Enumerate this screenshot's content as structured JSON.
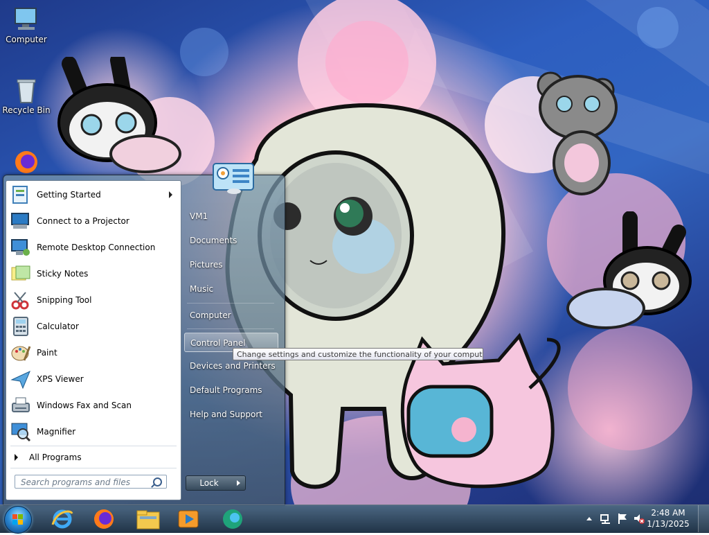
{
  "desktop": {
    "icons": [
      {
        "label": "Computer",
        "icon": "computer-icon"
      },
      {
        "label": "Recycle Bin",
        "icon": "recycle-bin-icon"
      },
      {
        "label": "",
        "icon": "firefox-icon"
      }
    ]
  },
  "start_menu": {
    "programs": [
      {
        "label": "Getting Started",
        "icon": "getting-started-icon",
        "has_submenu": true
      },
      {
        "label": "Connect to a Projector",
        "icon": "projector-icon"
      },
      {
        "label": "Remote Desktop Connection",
        "icon": "remote-desktop-icon"
      },
      {
        "label": "Sticky Notes",
        "icon": "sticky-notes-icon"
      },
      {
        "label": "Snipping Tool",
        "icon": "snipping-tool-icon"
      },
      {
        "label": "Calculator",
        "icon": "calculator-icon"
      },
      {
        "label": "Paint",
        "icon": "paint-icon"
      },
      {
        "label": "XPS Viewer",
        "icon": "xps-viewer-icon"
      },
      {
        "label": "Windows Fax and Scan",
        "icon": "fax-scan-icon"
      },
      {
        "label": "Magnifier",
        "icon": "magnifier-icon"
      }
    ],
    "all_programs": "All Programs",
    "search_placeholder": "Search programs and files",
    "right_items": [
      {
        "label": "VM1"
      },
      {
        "label": "Documents"
      },
      {
        "label": "Pictures"
      },
      {
        "label": "Music"
      },
      {
        "label": "Computer"
      },
      {
        "label": "Control Panel",
        "highlighted": true
      },
      {
        "label": "Devices and Printers"
      },
      {
        "label": "Default Programs"
      },
      {
        "label": "Help and Support"
      }
    ],
    "lock_label": "Lock",
    "tooltip": "Change settings and customize the functionality of your computer.",
    "user_picture_icon": "control-panel-icon"
  },
  "taskbar": {
    "pinned": [
      {
        "name": "internet-explorer-icon"
      },
      {
        "name": "firefox-icon"
      },
      {
        "name": "file-explorer-icon"
      },
      {
        "name": "media-player-icon"
      },
      {
        "name": "edge-icon"
      }
    ],
    "clock_time": "2:48 AM",
    "clock_date": "1/13/2025"
  },
  "colors": {
    "wallpaper_blue": "#2d5ec0",
    "wallpaper_pink": "#f2b9cf",
    "taskbar": "#1e3a56",
    "highlight": "#ffffff"
  }
}
